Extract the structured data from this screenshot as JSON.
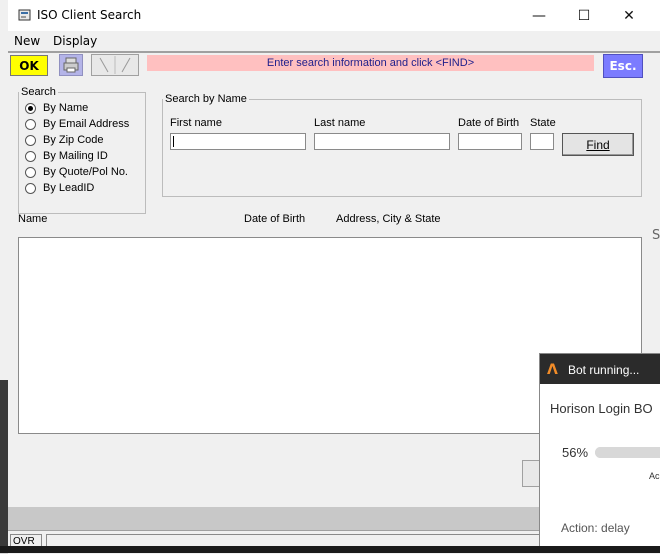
{
  "window": {
    "title": "ISO Client Search",
    "controls": {
      "minimize": "—",
      "maximize": "☐",
      "close": "✕"
    }
  },
  "menu": [
    "New",
    "Display"
  ],
  "toolbar": {
    "ok_label": "OK",
    "message": "Enter search information and click <FIND>",
    "esc_label": "Esc.",
    "colors": {
      "ok": "#ffff00",
      "esc": "#7b7bff",
      "message_bg": "#ffc0c0"
    }
  },
  "search": {
    "legend": "Search",
    "options": [
      {
        "label": "By Name",
        "checked": true
      },
      {
        "label": "By Email Address",
        "checked": false
      },
      {
        "label": "By Zip Code",
        "checked": false
      },
      {
        "label": "By Mailing ID",
        "checked": false
      },
      {
        "label": "By Quote/Pol No.",
        "checked": false
      },
      {
        "label": "By LeadID",
        "checked": false
      }
    ]
  },
  "name_search": {
    "legend": "Search by Name",
    "first_name_label": "First name",
    "last_name_label": "Last name",
    "dob_label": "Date of Birth",
    "state_label": "State",
    "first_name_value": "",
    "last_name_value": "",
    "dob_value": "",
    "state_value": "",
    "find_label": "Find"
  },
  "results": {
    "columns": [
      "Name",
      "Date of Birth",
      "Address, City & State"
    ],
    "rows": []
  },
  "status": {
    "mode": "OVR"
  },
  "peek": {
    "right_letter": "S"
  },
  "bot": {
    "title": "Bot running...",
    "job": "Horison Login BO",
    "progress_pct": 56,
    "progress_text": "56%",
    "small_text": "Ac",
    "action": "Action: delay"
  }
}
